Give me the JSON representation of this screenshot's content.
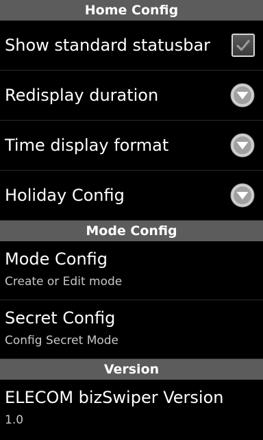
{
  "sections": [
    {
      "header": "Home Config"
    },
    {
      "header": "Mode Config"
    },
    {
      "header": "Version"
    }
  ],
  "home": {
    "show_statusbar": {
      "title": "Show standard statusbar",
      "checked": true
    },
    "redisplay_duration": {
      "title": "Redisplay duration"
    },
    "time_display_format": {
      "title": "Time display format"
    },
    "holiday_config": {
      "title": "Holiday Config"
    }
  },
  "mode": {
    "mode_config": {
      "title": "Mode Config",
      "summary": "Create or Edit mode"
    },
    "secret_config": {
      "title": "Secret Config",
      "summary": "Config Secret Mode"
    }
  },
  "version": {
    "app_version": {
      "title": "ELECOM bizSwiper Version",
      "summary": "1.0"
    }
  },
  "icons": {
    "checkbox": "check-icon",
    "dropdown": "chevron-down-icon"
  },
  "colors": {
    "background": "#000000",
    "header": "#5c5c5c",
    "summary_text": "#c8c8c8"
  }
}
